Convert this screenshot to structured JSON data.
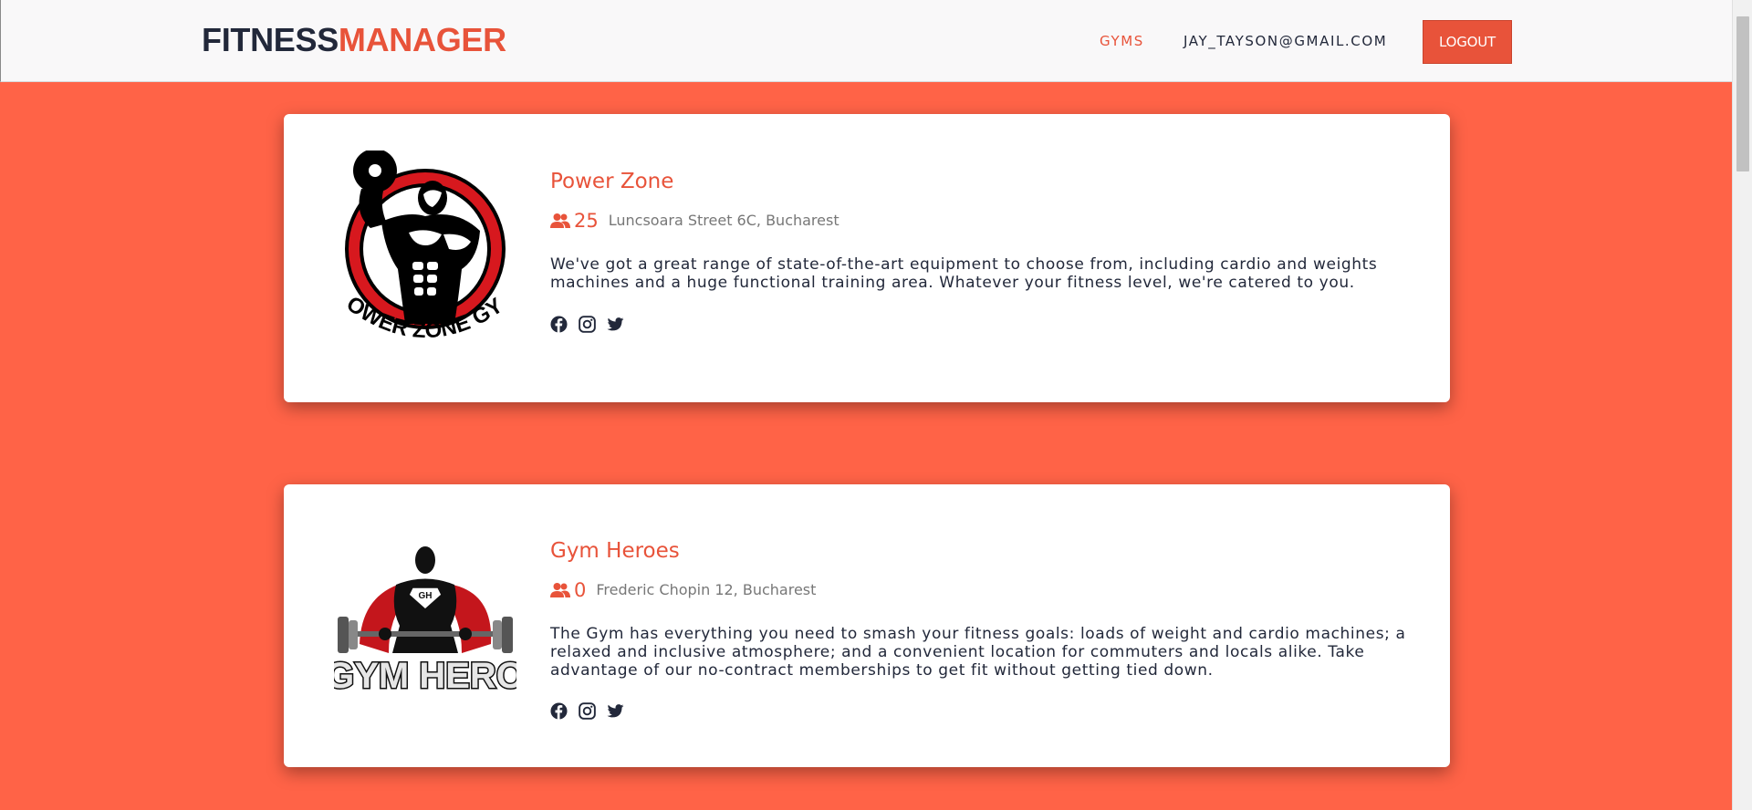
{
  "header": {
    "brand_part1": "FITNESS",
    "brand_part2": "MANAGER",
    "nav": {
      "gyms": "GYMS",
      "user_email": "JAY_TAYSON@GMAIL.COM",
      "logout": "LOGOUT"
    }
  },
  "colors": {
    "accent": "#e8533a",
    "page_background": "#ff6347",
    "navbar_background": "#f9f8f9",
    "dark_text": "#22283a"
  },
  "gyms": [
    {
      "name": "Power Zone",
      "members": "25",
      "address": "Luncsoara Street 6C, Bucharest",
      "description": "We've got a great range of state-of-the-art equipment to choose from, including cardio and weights machines and a huge functional training area. Whatever your fitness level, we're catered to you.",
      "logo_text": "POWER ZONE GYM",
      "icons": {
        "members": "users-icon",
        "socials": [
          "facebook-icon",
          "instagram-icon",
          "twitter-icon"
        ]
      }
    },
    {
      "name": "Gym Heroes",
      "members": "0",
      "address": "Frederic Chopin 12, Bucharest",
      "description": "The Gym has everything you need to smash your fitness goals: loads of weight and cardio machines; a relaxed and inclusive atmosphere; and a convenient location for commuters and locals alike. Take advantage of our no-contract memberships to get fit without getting tied down.",
      "logo_text": "GYM HERO",
      "logo_emblem": "GH",
      "icons": {
        "members": "users-icon",
        "socials": [
          "facebook-icon",
          "instagram-icon",
          "twitter-icon"
        ]
      }
    }
  ]
}
